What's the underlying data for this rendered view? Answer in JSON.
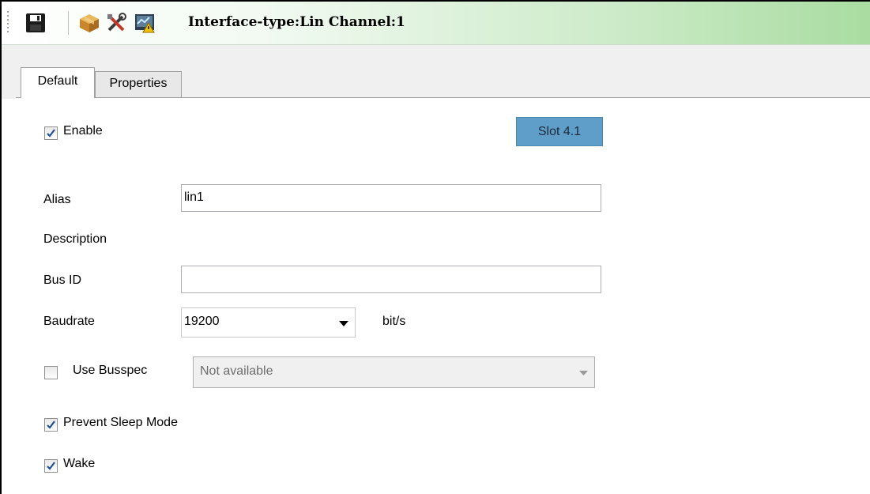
{
  "toolbar": {
    "title": "Interface-type:Lin Channel:1",
    "icons": [
      "save-icon",
      "package-icon",
      "tools-icon",
      "monitor-warning-icon"
    ]
  },
  "tabs": [
    {
      "label": "Default",
      "active": true
    },
    {
      "label": "Properties",
      "active": false
    }
  ],
  "form": {
    "enable": {
      "label": "Enable",
      "checked": true
    },
    "slot_button": "Slot 4.1",
    "alias": {
      "label": "Alias",
      "value": "lin1"
    },
    "description": {
      "label": "Description"
    },
    "bus_id": {
      "label": "Bus ID",
      "value": ""
    },
    "baudrate": {
      "label": "Baudrate",
      "value": "19200",
      "unit": "bit/s"
    },
    "use_busspec": {
      "label": "Use Busspec",
      "checked": false,
      "value": "Not available"
    },
    "prevent_sleep": {
      "label": "Prevent Sleep Mode",
      "checked": true
    },
    "wake": {
      "label": "Wake",
      "checked": true
    }
  },
  "colors": {
    "toolbar_gradient_end": "#a9dca1",
    "slot_button_bg": "#5f9ec9",
    "check_color": "#1f4f96"
  }
}
